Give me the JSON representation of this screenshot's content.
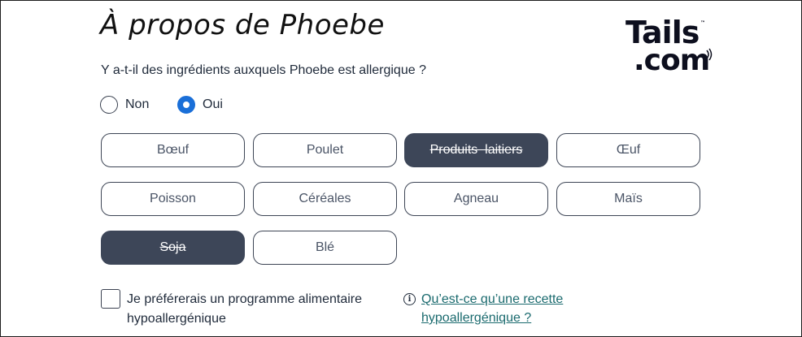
{
  "title": "À propos de Phoebe",
  "logo": {
    "line1": "Tails",
    "line2": ".com",
    "tm": "™"
  },
  "question": "Y a-t-il des ingrédients auxquels Phoebe est allergique ?",
  "allergy_answer": {
    "options": [
      {
        "label": "Non",
        "checked": false
      },
      {
        "label": "Oui",
        "checked": true
      }
    ]
  },
  "ingredients": [
    {
      "label": "Bœuf",
      "selected": false
    },
    {
      "label": "Poulet",
      "selected": false
    },
    {
      "label": "Produits  laitiers",
      "selected": true
    },
    {
      "label": "Œuf",
      "selected": false
    },
    {
      "label": "Poisson",
      "selected": false
    },
    {
      "label": "Céréales",
      "selected": false
    },
    {
      "label": "Agneau",
      "selected": false
    },
    {
      "label": "Maïs",
      "selected": false
    },
    {
      "label": "Soja",
      "selected": true
    },
    {
      "label": "Blé",
      "selected": false
    }
  ],
  "hypoallergenic": {
    "label": "Je préférerais un programme alimentaire hypoallergénique",
    "checked": false,
    "info_icon": "info-icon",
    "link": "Qu’est-ce qu’une recette hypoallergénique ?"
  },
  "colors": {
    "accent": "#1a6fd8",
    "selected_chip": "#3d4658",
    "link": "#1a6a6e"
  }
}
